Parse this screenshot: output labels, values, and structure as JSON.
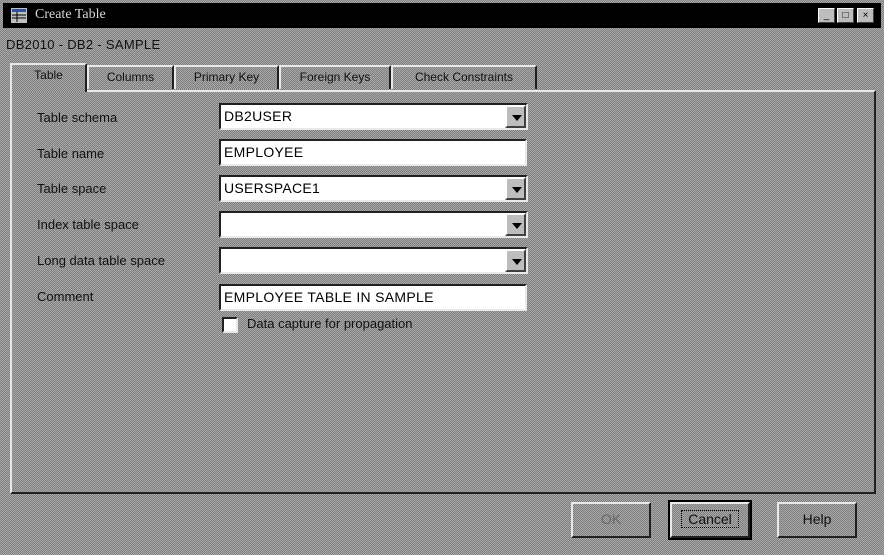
{
  "window": {
    "title": "Create Table",
    "subtitle": "DB2010 - DB2 - SAMPLE",
    "controls": {
      "minimize": "_",
      "maximize": "□",
      "close": "×"
    }
  },
  "tabs": [
    {
      "label": "Table",
      "active": true
    },
    {
      "label": "Columns",
      "active": false
    },
    {
      "label": "Primary Key",
      "active": false
    },
    {
      "label": "Foreign Keys",
      "active": false
    },
    {
      "label": "Check Constraints",
      "active": false
    }
  ],
  "form": {
    "schema": {
      "label": "Table schema",
      "value": "DB2USER"
    },
    "name": {
      "label": "Table name",
      "value": "EMPLOYEE"
    },
    "space": {
      "label": "Table space",
      "value": "USERSPACE1"
    },
    "index_space": {
      "label": "Index table space",
      "value": ""
    },
    "long_space": {
      "label": "Long data table space",
      "value": ""
    },
    "comment": {
      "label": "Comment",
      "value": "EMPLOYEE TABLE IN SAMPLE"
    },
    "capture": {
      "label": "Data capture for propagation",
      "checked": false
    }
  },
  "buttons": {
    "ok": "OK",
    "cancel": "Cancel",
    "help": "Help"
  }
}
